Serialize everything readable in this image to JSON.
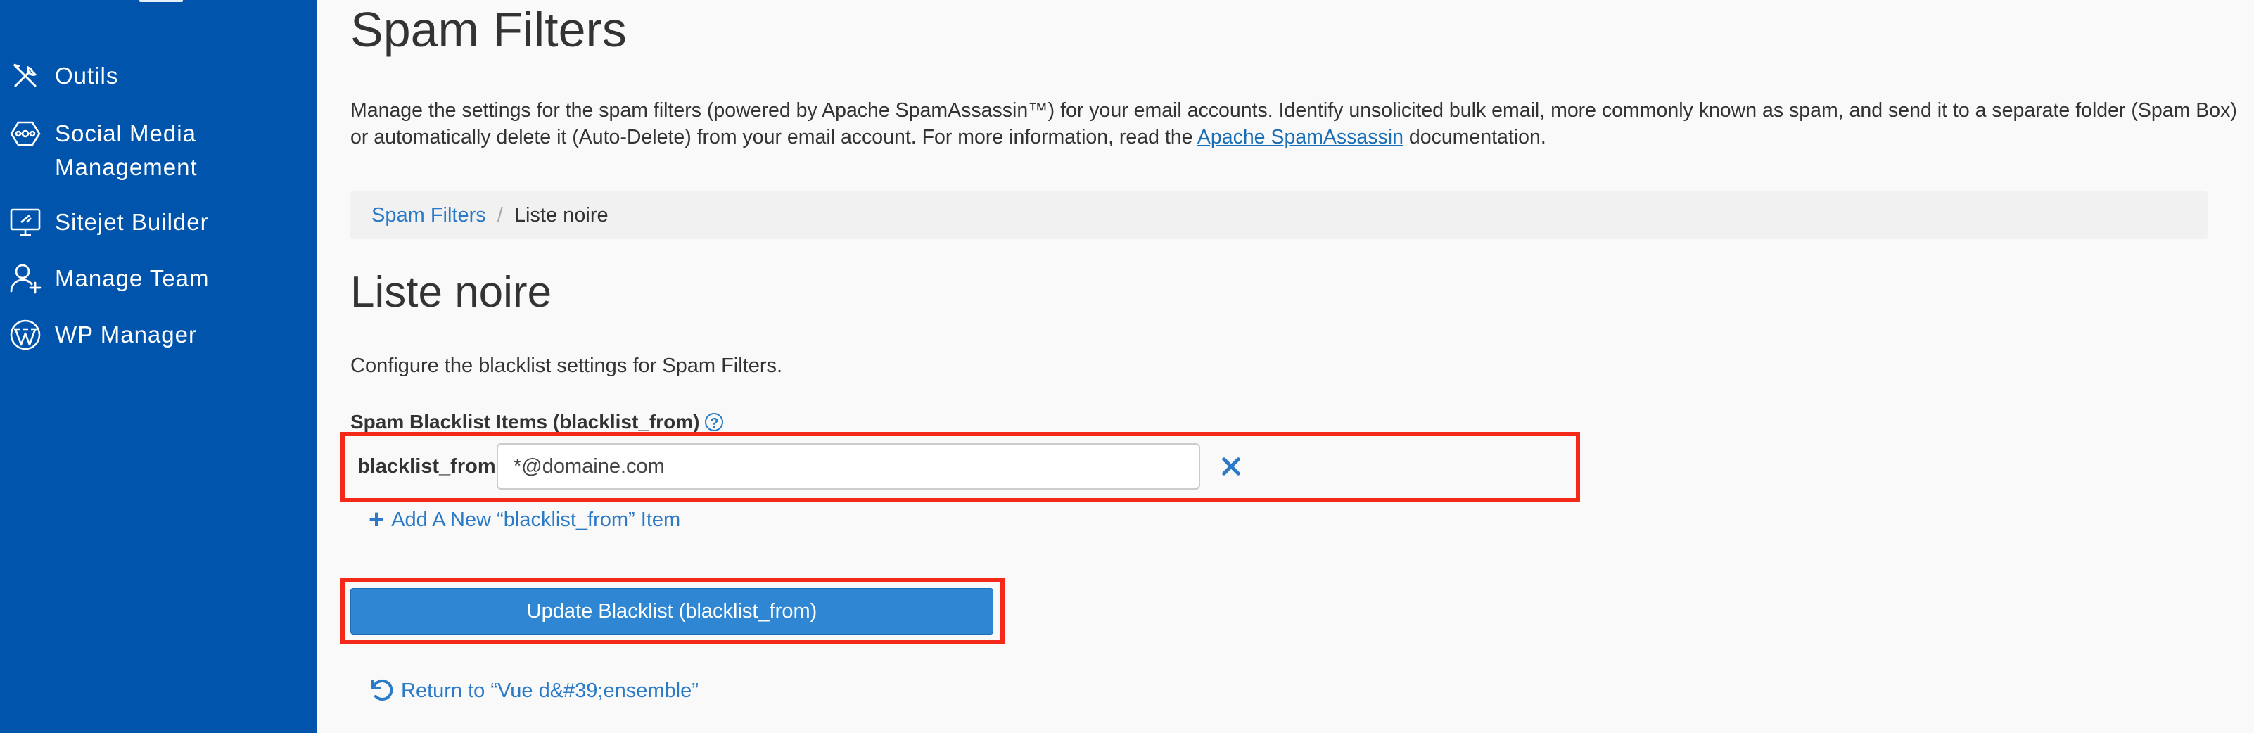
{
  "sidebar": {
    "items": [
      {
        "label": "Outils",
        "icon": "tools-icon"
      },
      {
        "label": "Social Media\nManagement",
        "icon": "social-media-icon"
      },
      {
        "label": "Sitejet Builder",
        "icon": "sitejet-icon"
      },
      {
        "label": "Manage Team",
        "icon": "manage-team-icon"
      },
      {
        "label": "WP Manager",
        "icon": "wordpress-icon"
      }
    ]
  },
  "page": {
    "title": "Spam Filters",
    "description_before_link": "Manage the settings for the spam filters (powered by Apache SpamAssassin™) for your email accounts. Identify unsolicited bulk email, more commonly known as spam, and send it to a separate folder (Spam Box) or automatically delete it (Auto-Delete) from your email account. For more information, read the ",
    "description_link": "Apache SpamAssassin",
    "description_after_link": " documentation."
  },
  "breadcrumb": {
    "parent": "Spam Filters",
    "separator": "/",
    "current": "Liste noire"
  },
  "section": {
    "title": "Liste noire",
    "description": "Configure the blacklist settings for Spam Filters.",
    "field_label": "Spam Blacklist Items (blacklist_from)",
    "help_icon": "?"
  },
  "blacklist": {
    "items": [
      {
        "key": "blacklist_from",
        "value": "*@domaine.com"
      }
    ],
    "add_item_label": "Add A New “blacklist_from” Item",
    "update_button": "Update Blacklist (blacklist_from)",
    "return_link": "Return to “Vue d&#39;ensemble”"
  },
  "colors": {
    "sidebar": "#0154ab",
    "link": "#2a7ac7",
    "button": "#2f87d4",
    "highlight": "#f4291a"
  }
}
